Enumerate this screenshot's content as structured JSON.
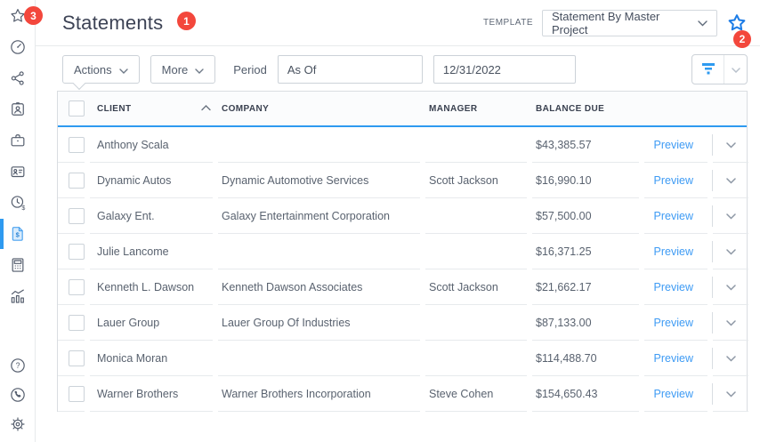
{
  "header": {
    "title": "Statements",
    "template_label": "TEMPLATE",
    "template_value": "Statement By Master Project"
  },
  "annotations": {
    "badge1": "1",
    "badge2": "2",
    "badge3": "3"
  },
  "sidebar": {
    "active_item": "statement-document",
    "icons": [
      "favorites-star",
      "dashboard-gauge",
      "share-network",
      "contact-badge",
      "briefcase",
      "id-card",
      "time-and-money-clock",
      "statement-document",
      "calculator",
      "analytics-chart",
      "help-circle",
      "phone-circle",
      "settings-gear"
    ]
  },
  "toolbar": {
    "actions_label": "Actions",
    "more_label": "More",
    "period_label": "Period",
    "period_value": "As Of",
    "date_value": "12/31/2022"
  },
  "table": {
    "columns": [
      "CLIENT",
      "COMPANY",
      "MANAGER",
      "BALANCE DUE"
    ],
    "sort": {
      "column": "CLIENT",
      "direction": "asc"
    },
    "rows": [
      {
        "client": "Anthony Scala",
        "company": "",
        "manager": "",
        "balance": "$43,385.57",
        "action": "Preview"
      },
      {
        "client": "Dynamic Autos",
        "company": "Dynamic Automotive Services",
        "manager": "Scott Jackson",
        "balance": "$16,990.10",
        "action": "Preview"
      },
      {
        "client": "Galaxy Ent.",
        "company": "Galaxy Entertainment Corporation",
        "manager": "",
        "balance": "$57,500.00",
        "action": "Preview"
      },
      {
        "client": "Julie Lancome",
        "company": "",
        "manager": "",
        "balance": "$16,371.25",
        "action": "Preview"
      },
      {
        "client": "Kenneth L. Dawson",
        "company": "Kenneth Dawson Associates",
        "manager": "Scott Jackson",
        "balance": "$21,662.17",
        "action": "Preview"
      },
      {
        "client": "Lauer Group",
        "company": "Lauer Group Of Industries",
        "manager": "",
        "balance": "$87,133.00",
        "action": "Preview"
      },
      {
        "client": "Monica Moran",
        "company": "",
        "manager": "",
        "balance": "$114,488.70",
        "action": "Preview"
      },
      {
        "client": "Warner Brothers",
        "company": "Warner Brothers Incorporation",
        "manager": "Steve Cohen",
        "balance": "$154,650.43",
        "action": "Preview"
      }
    ]
  },
  "colors": {
    "accent_blue": "#2e9af0",
    "link_blue": "#3e9bf4",
    "badge_red": "#f3473c",
    "star_blue": "#1c7ce6",
    "border_gray": "#ccd2d8"
  }
}
